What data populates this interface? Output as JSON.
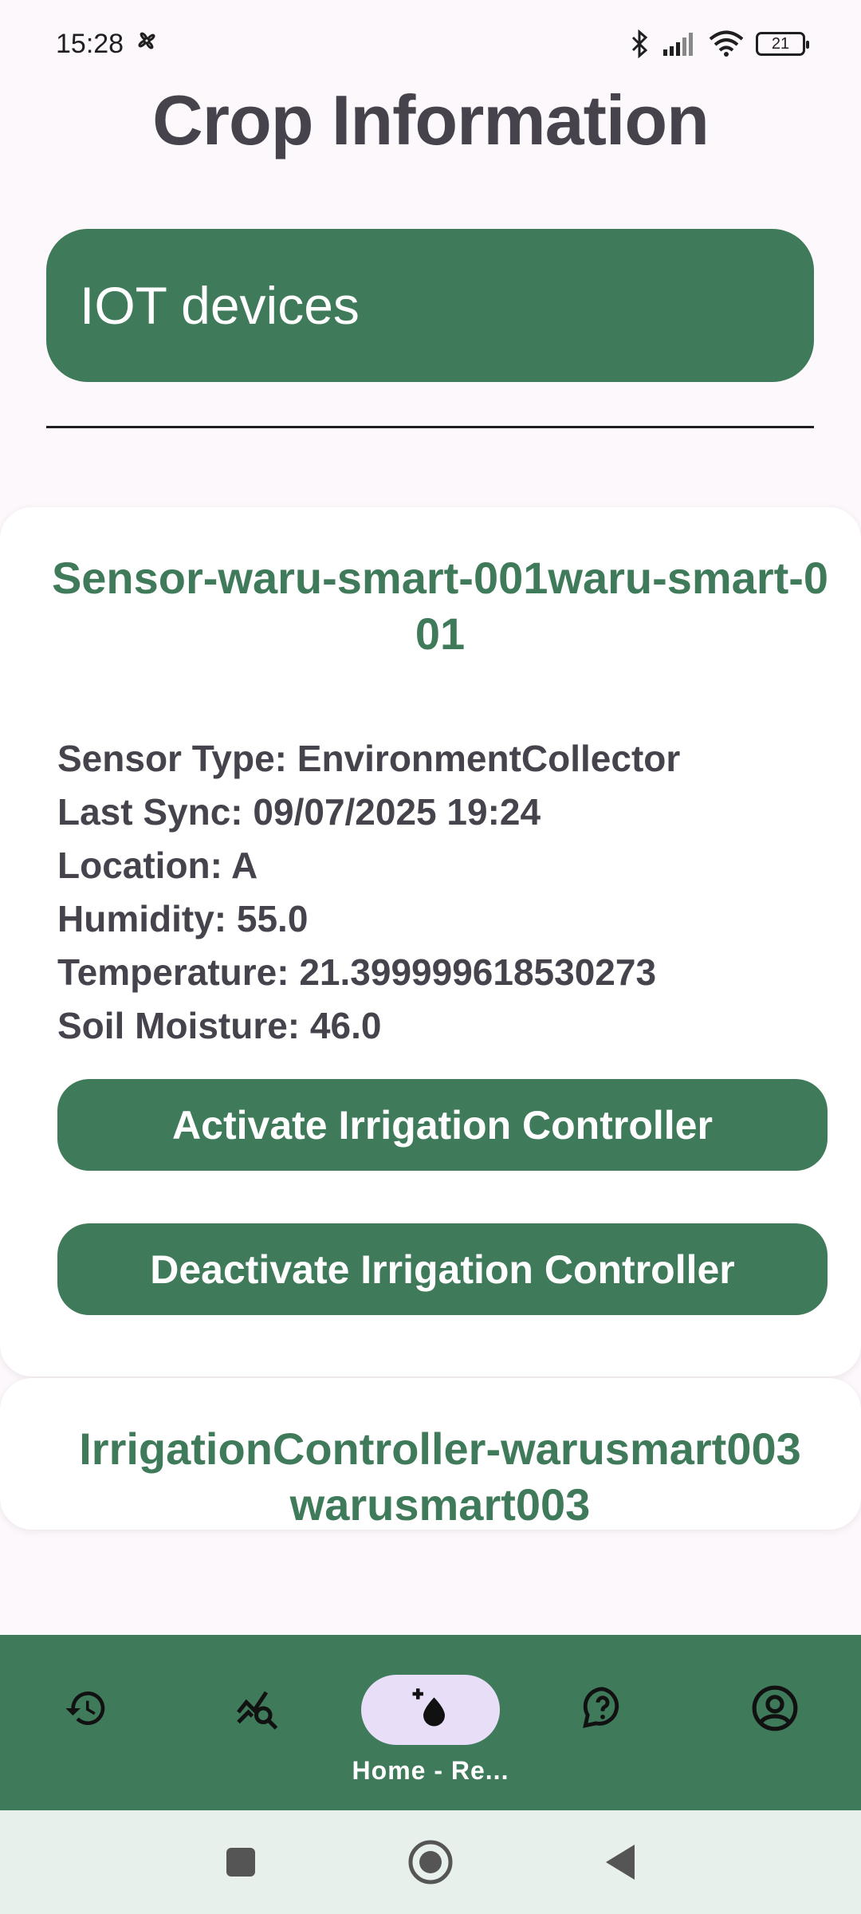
{
  "status_bar": {
    "time": "15:28",
    "battery": "21",
    "icons": [
      "fan-icon",
      "bluetooth-icon",
      "signal-icon",
      "wifi-icon",
      "battery-icon"
    ]
  },
  "page": {
    "title": "Crop Information"
  },
  "iot_button": {
    "label": "IOT devices"
  },
  "devices": [
    {
      "title": "Sensor-waru-smart-001waru-smart-001",
      "details": [
        "Sensor Type: EnvironmentCollector",
        "Last Sync: 09/07/2025 19:24",
        "Location: A",
        "Humidity: 55.0",
        "Temperature: 21.399999618530273",
        "Soil Moisture: 46.0"
      ],
      "activate_label": "Activate Irrigation Controller",
      "deactivate_label": "Deactivate Irrigation Controller"
    },
    {
      "title": "IrrigationController-warusmart003 warusmart003"
    }
  ],
  "bottom_nav": {
    "items": [
      {
        "icon": "history-icon",
        "label": ""
      },
      {
        "icon": "analytics-search-icon",
        "label": ""
      },
      {
        "icon": "add-water-drop-icon",
        "label": "Home - Re..."
      },
      {
        "icon": "help-icon",
        "label": ""
      },
      {
        "icon": "account-icon",
        "label": ""
      }
    ],
    "active_index": 2
  },
  "colors": {
    "primary": "#3f7a5a",
    "background": "#fdf8fc",
    "card": "#ffffff",
    "text": "#46434d",
    "active_pill": "#e8def8"
  }
}
